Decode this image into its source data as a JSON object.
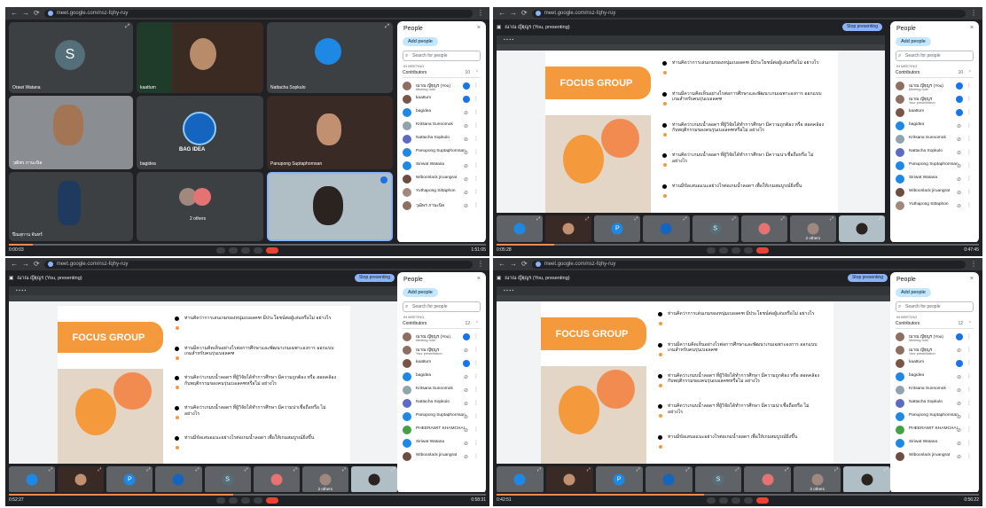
{
  "url": "meet.google.com/nsz-fqhy-ruy",
  "meet_code": "4:51 PM | nsz-fqhy-ruy",
  "q1": {
    "tiles": [
      {
        "name": "Orawi Watana",
        "initial": "S",
        "avatar_color": "#546e7a"
      },
      {
        "name": "kaattum"
      },
      {
        "name": "Nattacha Sopkulo"
      },
      {
        "name": "วุฒิพร ภานะนิล"
      },
      {
        "name": "bagidea",
        "logo": "BAG IDEA"
      },
      {
        "name": "Panupong Suptaphornsan"
      },
      {
        "name": "ปีณสุกาน จันทร์"
      },
      {
        "name": "2 others"
      },
      {
        "name": ""
      }
    ],
    "time_left": "0:00:03",
    "time_right": "1:51:05",
    "progress_fraction": 0.05
  },
  "presenting_title": "ณาณ ญีฐุญร (You, presenting)",
  "stop_label": "Stop presenting",
  "slide": {
    "title": "FOCUS GROUP",
    "bullets": [
      "ท่านคิดว่าการเล่นเกมของหนุ่มเบอลคฑ มีประโยชน์ต่อผู้เล่นหรือไม่ อย่างไร",
      "ท่านมีความคิดเห็นอย่างไรต่อการศึกษาและพัฒนาเกมเฉพาะองการ ออกแบบเกมสำหรับคนรุ่นเบอลคฑ",
      "ท่านคิดว่าเกมบน้ำลอดฯ ที่ผู้วิจัยได้ทำการศึกษา มีความถูกต้อง หรือ สอดคล้องกับพฤติกรรมของคนรุ่นเบอลคฑหรือไม่ อย่างไร",
      "ท่านคิดว่าเกมบน้ำลอดฯ ที่ผู้วิจัยได้ทำการศึกษา มีความน่าเชื่อถือหรือ ไม่ อย่างไร",
      "ท่านมีข้อเสนอแนะอย่างไรต่อเกมน้ำลอดฯ เพื่อให้เกมสมบูรณ์ยิ่งขึ้น"
    ]
  },
  "people": {
    "title": "People",
    "close": "×",
    "add_label": "Add people",
    "search_placeholder": "Search for people",
    "in_meeting": "IN MEETING",
    "contributors": "Contributors",
    "count_q1": "10",
    "count_q3": "12",
    "q1_list": [
      {
        "name": "ณาณ ญีฐุญร (You)",
        "sub": "Meeting host",
        "color": "#8d6e63",
        "speaking": true
      },
      {
        "name": "kaattum",
        "color": "#795548",
        "speaking": true
      },
      {
        "name": "bagidea",
        "color": "#1e88e5"
      },
      {
        "name": "Kritsana Sunnomok",
        "color": "#90a4ae"
      },
      {
        "name": "Nattacha Sopkulo",
        "color": "#5c6bc0"
      },
      {
        "name": "Panupong Suptaphornsan",
        "color": "#1e88e5"
      },
      {
        "name": "Siriwat Watana",
        "color": "#1e88e5"
      },
      {
        "name": "Wiboonlack jiruangrat",
        "color": "#6d4c41"
      },
      {
        "name": "Yuthapong Sittaphon",
        "color": "#a1887f"
      },
      {
        "name": "วุฒิพร ภานะนิล",
        "color": "#8d6e63"
      }
    ],
    "q3_list": [
      {
        "name": "ณาณ ญีฐุญร (You)",
        "sub": "Meeting host",
        "color": "#8d6e63",
        "speaking": true
      },
      {
        "name": "ณาณ ญีฐุญร",
        "sub": "Your presentation",
        "color": "#8d6e63"
      },
      {
        "name": "kaattum",
        "color": "#795548",
        "speaking": true
      },
      {
        "name": "bagidea",
        "color": "#1e88e5"
      },
      {
        "name": "Kritsana Sunnomok",
        "color": "#90a4ae"
      },
      {
        "name": "Nattacha Sopkulo",
        "color": "#5c6bc0"
      },
      {
        "name": "Panupong Suptaphornsan",
        "color": "#1e88e5"
      },
      {
        "name": "PHEERAWIT KHAMCHAI",
        "color": "#43a047"
      },
      {
        "name": "Siriwat Watana",
        "color": "#1e88e5"
      },
      {
        "name": "Wiboonlack jiruangrat",
        "color": "#6d4c41"
      }
    ],
    "q2_list": [
      {
        "name": "ณาณ ญีฐุญร (You)",
        "sub": "Meeting host",
        "color": "#8d6e63",
        "speaking": true
      },
      {
        "name": "ณาณ ญีฐุญร",
        "sub": "Your presentation",
        "color": "#8d6e63",
        "speaking": true
      },
      {
        "name": "kaattum",
        "color": "#795548",
        "speaking": true
      },
      {
        "name": "bagidea",
        "color": "#1e88e5"
      },
      {
        "name": "Kritsana Sunnomok",
        "color": "#90a4ae"
      },
      {
        "name": "Nattacha Sopkulo",
        "color": "#5c6bc0"
      },
      {
        "name": "Panupong Suptaphornsan",
        "color": "#1e88e5"
      },
      {
        "name": "Siriwat Watana",
        "color": "#1e88e5"
      },
      {
        "name": "Wiboonlack jiruangrat",
        "color": "#6d4c41"
      },
      {
        "name": "Yuthapong Sittaphon",
        "color": "#a1887f"
      }
    ]
  },
  "strip_others": "2 others",
  "q2_time": {
    "left": "0:05:28",
    "right": "0:47:45",
    "progress_fraction": 0.12
  },
  "q3_time": {
    "left": "0:52:27",
    "right": "0:58:31",
    "progress_fraction": 0.47
  },
  "q4_time": {
    "left": "0:42:51",
    "right": "0:56:22",
    "progress_fraction": 0.43
  },
  "strip_initials": {
    "p": "P",
    "s": "S"
  }
}
